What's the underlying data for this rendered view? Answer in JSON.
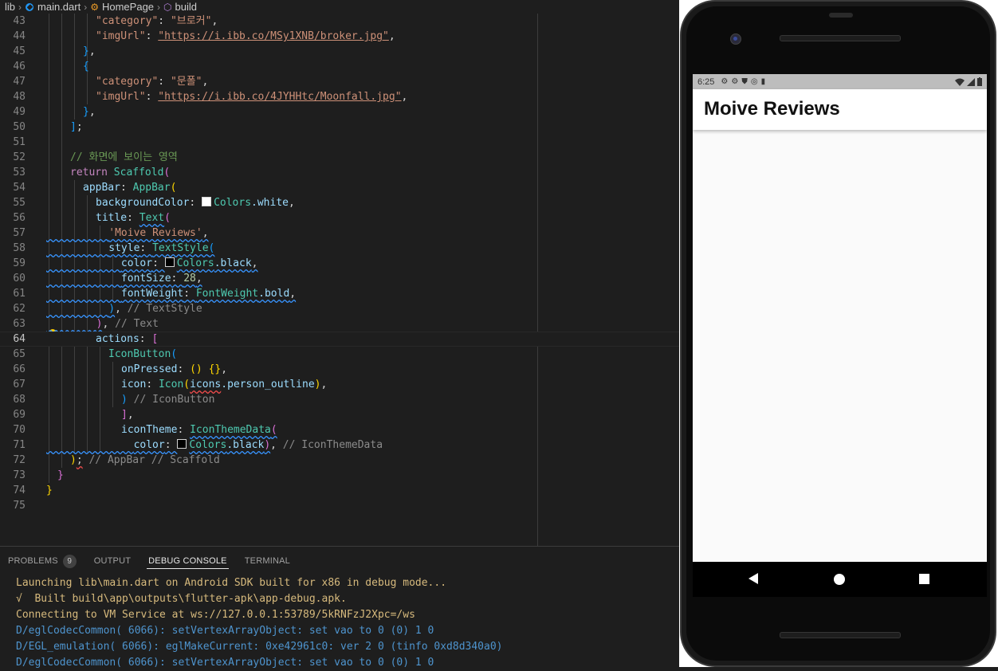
{
  "breadcrumb": {
    "items": [
      "lib",
      "main.dart",
      "HomePage",
      "build"
    ]
  },
  "editor": {
    "lines": [
      {
        "n": "43"
      },
      {
        "n": "44"
      },
      {
        "n": "45"
      },
      {
        "n": "46"
      },
      {
        "n": "47"
      },
      {
        "n": "48"
      },
      {
        "n": "49"
      },
      {
        "n": "50"
      },
      {
        "n": "51"
      },
      {
        "n": "52"
      },
      {
        "n": "53"
      },
      {
        "n": "54"
      },
      {
        "n": "55"
      },
      {
        "n": "56"
      },
      {
        "n": "57"
      },
      {
        "n": "58"
      },
      {
        "n": "59"
      },
      {
        "n": "60"
      },
      {
        "n": "61"
      },
      {
        "n": "62"
      },
      {
        "n": "63"
      },
      {
        "n": "64"
      },
      {
        "n": "65"
      },
      {
        "n": "66"
      },
      {
        "n": "67"
      },
      {
        "n": "68"
      },
      {
        "n": "69"
      },
      {
        "n": "70"
      },
      {
        "n": "71"
      },
      {
        "n": "72"
      },
      {
        "n": "73"
      },
      {
        "n": "74"
      },
      {
        "n": "75"
      }
    ],
    "code": {
      "l43_key": "\"category\"",
      "l43_val": "\"브로커\"",
      "l44_key": "\"imgUrl\"",
      "l44_val": "\"https://i.ibb.co/MSy1XNB/broker.jpg\"",
      "l47_key": "\"category\"",
      "l47_val": "\"문폴\"",
      "l48_key": "\"imgUrl\"",
      "l48_val": "\"https://i.ibb.co/4JYHHtc/Moonfall.jpg\"",
      "l52_comment": "// 화면에 보이는 영역",
      "l53_kw": "return",
      "l53_cls": "Scaffold",
      "l54_prop": "appBar",
      "l54_cls": "AppBar",
      "l55_prop": "backgroundColor",
      "l55_cls": "Colors",
      "l55_member": ".white",
      "l56_prop": "title",
      "l56_cls": "Text",
      "l57_str": "'Moive Reviews'",
      "l58_prop": "style",
      "l58_cls": "TextStyle",
      "l59_prop": "color",
      "l59_cls": "Colors",
      "l59_member": ".black",
      "l60_prop": "fontSize",
      "l60_num": "28",
      "l61_prop": "fontWeight",
      "l61_cls": "FontWeight",
      "l61_member": ".bold",
      "l62_hint": "// TextStyle",
      "l63_hint": "// Text",
      "l64_prop": "actions",
      "l65_cls": "IconButton",
      "l66_prop": "onPressed",
      "l66_rest": "() {}",
      "l67_prop": "icon",
      "l67_cls": "Icon",
      "l67_arg": "icons",
      "l67_member": ".person_outline",
      "l68_hint": "// IconButton",
      "l70_prop": "iconTheme",
      "l70_cls": "IconThemeData",
      "l71_prop": "color",
      "l71_cls": "Colors",
      "l71_member": ".black",
      "l71_hint": "// IconThemeData",
      "l72_hint": "// AppBar // Scaffold"
    }
  },
  "panel": {
    "tabs": [
      {
        "label": "PROBLEMS",
        "badge": "9"
      },
      {
        "label": "OUTPUT"
      },
      {
        "label": "DEBUG CONSOLE"
      },
      {
        "label": "TERMINAL"
      }
    ],
    "active_tab": "DEBUG CONSOLE",
    "console": [
      "Launching lib\\main.dart on Android SDK built for x86 in debug mode...",
      "√  Built build\\app\\outputs\\flutter-apk\\app-debug.apk.",
      "Connecting to VM Service at ws://127.0.0.1:53789/5kRNFzJ2Xpc=/ws",
      "D/eglCodecCommon( 6066): setVertexArrayObject: set vao to 0 (0) 1 0",
      "D/EGL_emulation( 6066): eglMakeCurrent: 0xe42961c0: ver 2 0 (tinfo 0xd8d340a0)",
      "D/eglCodecCommon( 6066): setVertexArrayObject: set vao to 0 (0) 1 0"
    ]
  },
  "emulator": {
    "status_time": "6:25",
    "status_icons_left": [
      "gear-icon",
      "gear-icon",
      "shield-icon",
      "data-saver-icon",
      "sd-card-icon"
    ],
    "status_icons_right": [
      "wifi-icon",
      "signal-icon",
      "battery-icon"
    ],
    "app_title": "Moive Reviews",
    "nav_buttons": [
      "back-icon",
      "home-icon",
      "recents-icon"
    ]
  },
  "colors": {
    "editor_bg": "#1e1e1e",
    "string": "#ce9178",
    "keyword": "#c586c0",
    "class": "#4ec9b0",
    "property": "#9cdcfe",
    "comment": "#6a9955",
    "console_warn": "#d7ba7d",
    "console_info": "#4e94ce"
  }
}
